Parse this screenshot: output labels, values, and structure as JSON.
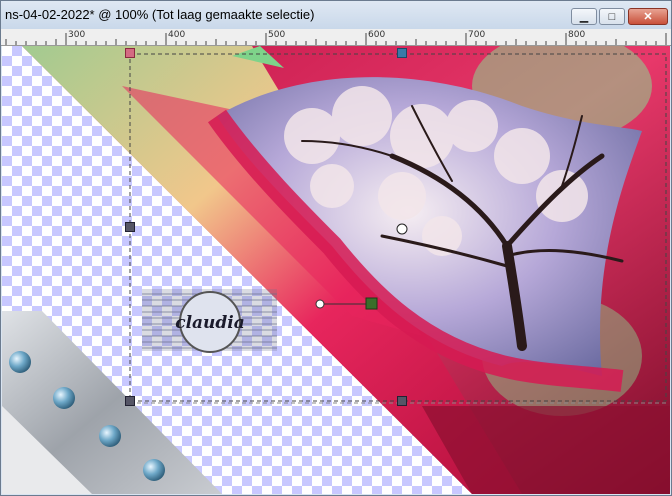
{
  "window": {
    "title": "ns-04-02-2022* @ 100% (Tot laag gemaakte selectie)",
    "buttons": {
      "minimize": "▁",
      "maximize": "□",
      "close": "✕"
    }
  },
  "ruler": {
    "labels": [
      "300",
      "400",
      "500",
      "600",
      "700",
      "800"
    ]
  },
  "canvas": {
    "watermark_text": "claudia",
    "colors": {
      "checker": "#c8c8ff",
      "magenta": "#e0245e",
      "green": "#7ed38a",
      "dark_red": "#6e0a22",
      "silver": "#b9bcc2"
    }
  }
}
